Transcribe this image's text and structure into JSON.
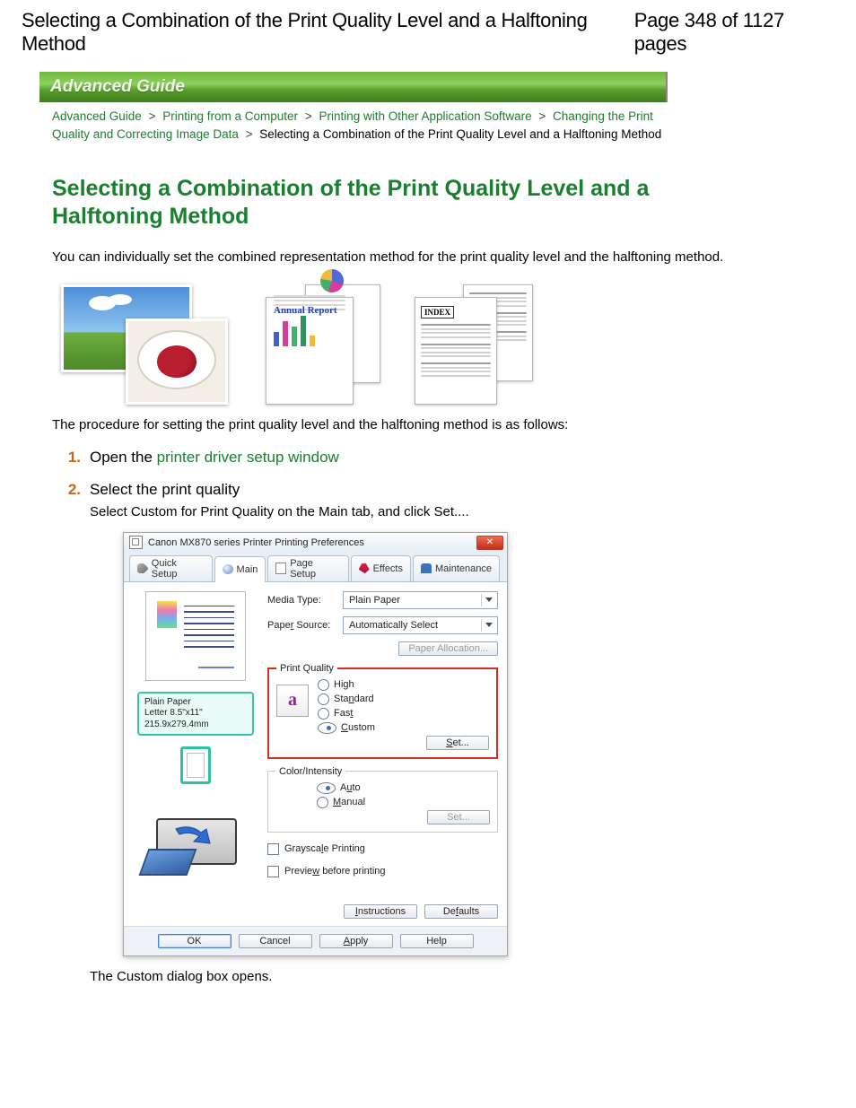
{
  "header": {
    "title": "Selecting a Combination of the Print Quality Level and a Halftoning Method",
    "page_indicator": "Page 348 of 1127 pages"
  },
  "guide_bar": "Advanced Guide",
  "breadcrumb": {
    "links": [
      "Advanced Guide",
      "Printing from a Computer",
      "Printing with Other Application Software",
      "Changing the Print Quality and Correcting Image Data"
    ],
    "current": "Selecting a Combination of the Print Quality Level and a Halftoning Method",
    "separator": ">"
  },
  "title": "Selecting a Combination of the Print Quality Level and a Halftoning Method",
  "intro": "You can individually set the combined representation method for the print quality level and the halftoning method.",
  "thumbs": {
    "annual_report": "Annual Report",
    "index": "INDEX"
  },
  "procedure_line": "The procedure for setting the print quality level and the halftoning method is as follows:",
  "steps": [
    {
      "num": "1.",
      "lead_pre": "Open the ",
      "lead_link": "printer driver setup window"
    },
    {
      "num": "2.",
      "lead": "Select the print quality",
      "detail": "Select Custom for Print Quality on the Main tab, and click Set....",
      "after_dialog": "The Custom dialog box opens."
    }
  ],
  "dialog": {
    "title": "Canon MX870 series Printer Printing Preferences",
    "tabs": [
      "Quick Setup",
      "Main",
      "Page Setup",
      "Effects",
      "Maintenance"
    ],
    "active_tab": 1,
    "preview": {
      "label_line1": "Plain Paper",
      "label_line2": "Letter 8.5\"x11\" 215.9x279.4mm"
    },
    "media_type": {
      "label": "Media Type:",
      "value": "Plain Paper"
    },
    "paper_source": {
      "label": "Paper Source:",
      "value": "Automatically Select"
    },
    "paper_allocation_btn": "Paper Allocation...",
    "print_quality": {
      "legend": "Print Quality",
      "options": [
        "High",
        "Standard",
        "Fast",
        "Custom"
      ],
      "underlines": [
        "g",
        "n",
        "t",
        "C"
      ],
      "selected": 3,
      "set_btn": "Set...",
      "icon_text": "a"
    },
    "color_intensity": {
      "legend": "Color/Intensity",
      "options": [
        "Auto",
        "Manual"
      ],
      "underlines": [
        "u",
        "M"
      ],
      "selected": 0,
      "set_btn": "Set..."
    },
    "grayscale": "Grayscale Printing",
    "preview_before": "Preview before printing",
    "inner_buttons": [
      "Instructions",
      "Defaults"
    ],
    "footer_buttons": [
      "OK",
      "Cancel",
      "Apply",
      "Help"
    ]
  }
}
